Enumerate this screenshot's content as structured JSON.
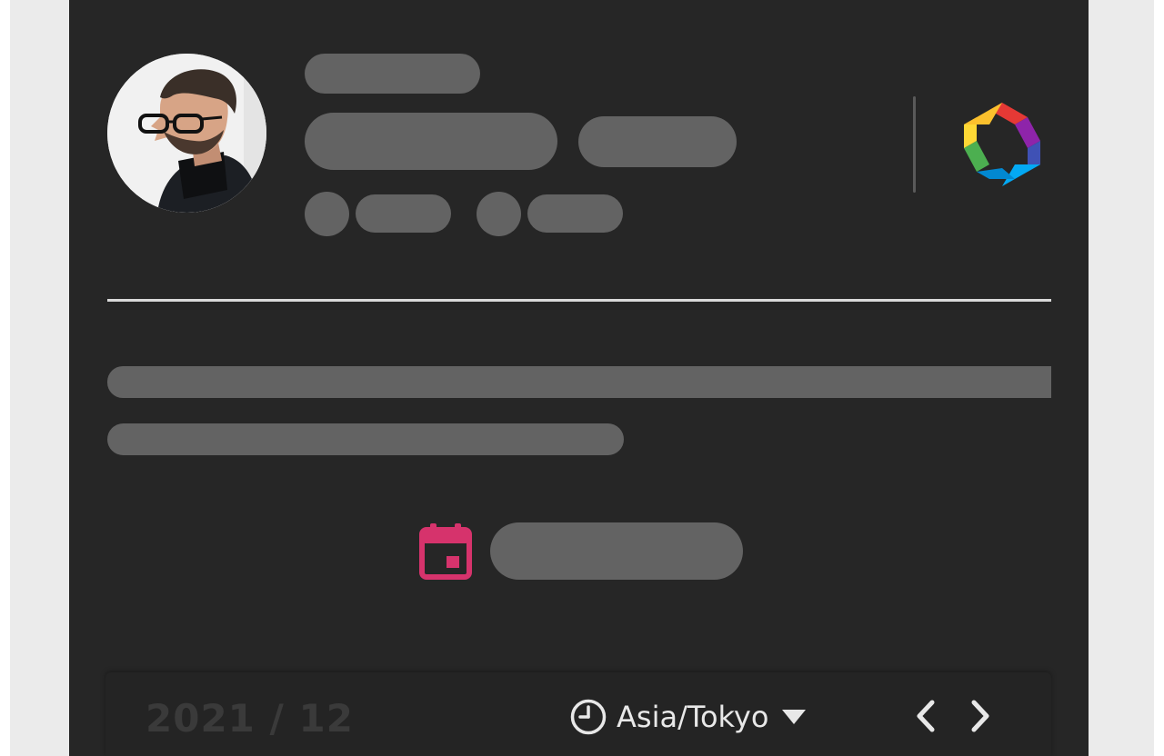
{
  "profile": {
    "avatar_alt": "profile photo"
  },
  "calendar": {
    "month_label": "2021 / 12",
    "timezone": "Asia/Tokyo"
  },
  "colors": {
    "panel_background": "#262626",
    "skeleton": "#636363",
    "accent_calendar": "#d6336c",
    "page_background": "#ebebeb"
  },
  "icons": {
    "timezone": "clock-icon",
    "dropdown": "caret-down-icon",
    "previous": "chevron-left-icon",
    "next": "chevron-right-icon",
    "date": "calendar-icon",
    "brand": "hexagon-logo-icon"
  }
}
